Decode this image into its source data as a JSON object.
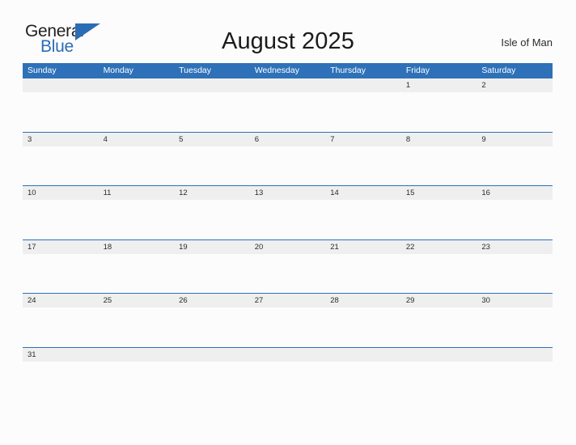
{
  "brand": {
    "name_part1": "General",
    "name_part2": "Blue",
    "flag_icon": "triangle-flag-icon",
    "color_primary": "#2a6db5",
    "color_text": "#231f20"
  },
  "header": {
    "title": "August 2025",
    "locale": "Isle of Man"
  },
  "calendar": {
    "month": "August",
    "year": "2025",
    "header_bg": "#2e71b8",
    "band_bg": "#efefef",
    "separator_color": "#2e71b8",
    "weekdays": [
      "Sunday",
      "Monday",
      "Tuesday",
      "Wednesday",
      "Thursday",
      "Friday",
      "Saturday"
    ],
    "weeks": [
      [
        "",
        "",
        "",
        "",
        "",
        "1",
        "2"
      ],
      [
        "3",
        "4",
        "5",
        "6",
        "7",
        "8",
        "9"
      ],
      [
        "10",
        "11",
        "12",
        "13",
        "14",
        "15",
        "16"
      ],
      [
        "17",
        "18",
        "19",
        "20",
        "21",
        "22",
        "23"
      ],
      [
        "24",
        "25",
        "26",
        "27",
        "28",
        "29",
        "30"
      ],
      [
        "31",
        "",
        "",
        "",
        "",
        "",
        ""
      ]
    ]
  }
}
